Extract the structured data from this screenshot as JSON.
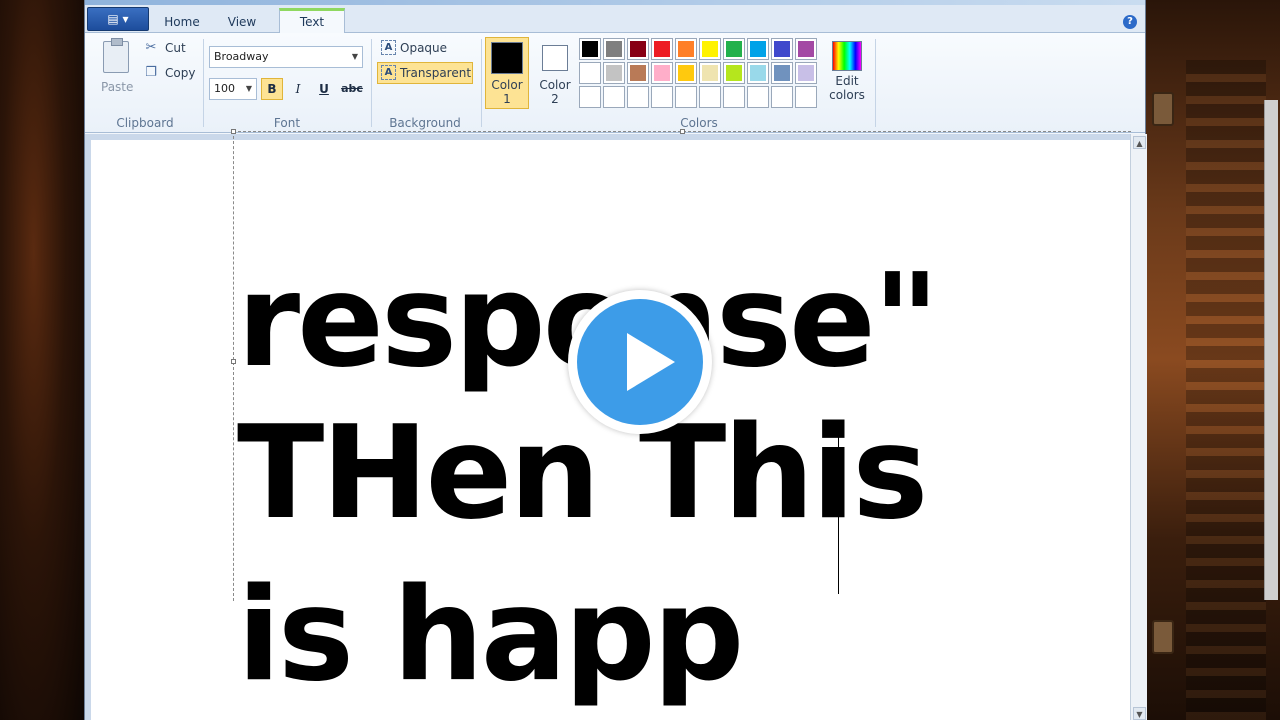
{
  "tabs": {
    "home": "Home",
    "view": "View",
    "text": "Text"
  },
  "app_menu": {
    "icon": "menu-icon",
    "label": "▤ ▾"
  },
  "help": {
    "label": "?"
  },
  "clipboard": {
    "paste": "Paste",
    "cut": "Cut",
    "copy": "Copy",
    "group": "Clipboard"
  },
  "font": {
    "family": "Broadway",
    "size": "100",
    "bold": "B",
    "italic": "I",
    "underline": "U",
    "strike": "abc",
    "group": "Font"
  },
  "background": {
    "opaque": "Opaque",
    "transparent": "Transparent",
    "group": "Background",
    "glyph": "A"
  },
  "colors": {
    "color1_line1": "Color",
    "color1_line2": "1",
    "color2_line1": "Color",
    "color2_line2": "2",
    "edit_line1": "Edit",
    "edit_line2": "colors",
    "group": "Colors",
    "color1_value": "#000000",
    "color2_value": "#ffffff",
    "palette_row1": [
      "#000000",
      "#7f7f7f",
      "#880015",
      "#ed1c24",
      "#ff7f27",
      "#fff200",
      "#22b14c",
      "#00a2e8",
      "#3f48cc",
      "#a349a4"
    ],
    "palette_row2": [
      "#ffffff",
      "#c3c3c3",
      "#b97a57",
      "#ffaec9",
      "#ffc90e",
      "#efe4b0",
      "#b5e61d",
      "#99d9ea",
      "#7092be",
      "#c8bfe7"
    ],
    "palette_row3": [
      "#ffffff",
      "#ffffff",
      "#ffffff",
      "#ffffff",
      "#ffffff",
      "#ffffff",
      "#ffffff",
      "#ffffff",
      "#ffffff",
      "#ffffff"
    ]
  },
  "canvas_text": {
    "line1": "response\"",
    "line2": "THen This",
    "line3": "is happ"
  },
  "overlay": {
    "play_icon": "play-icon"
  }
}
